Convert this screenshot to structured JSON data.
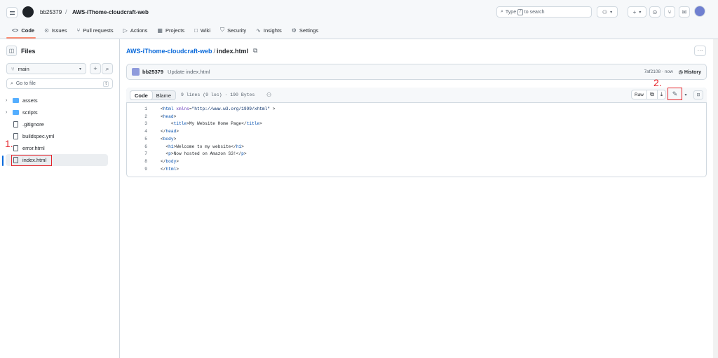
{
  "header": {
    "owner": "bb25379",
    "separator": "/",
    "repo": "AWS-iThome-cloudcraft-web",
    "search_prefix": "Type",
    "search_key": "/",
    "search_suffix": "to search",
    "plus_label": "+"
  },
  "tabs": [
    {
      "label": "Code",
      "icon": "code-icon",
      "glyph": "<>"
    },
    {
      "label": "Issues",
      "icon": "issue-icon",
      "glyph": "⊙"
    },
    {
      "label": "Pull requests",
      "icon": "pull-request-icon",
      "glyph": "⑂"
    },
    {
      "label": "Actions",
      "icon": "play-icon",
      "glyph": "▷"
    },
    {
      "label": "Projects",
      "icon": "table-icon",
      "glyph": "▦"
    },
    {
      "label": "Wiki",
      "icon": "book-icon",
      "glyph": "□"
    },
    {
      "label": "Security",
      "icon": "shield-icon",
      "glyph": "⛉"
    },
    {
      "label": "Insights",
      "icon": "graph-icon",
      "glyph": "∿"
    },
    {
      "label": "Settings",
      "icon": "gear-icon",
      "glyph": "⚙"
    }
  ],
  "sidebar": {
    "title": "Files",
    "branch": "main",
    "goto_placeholder": "Go to file",
    "goto_key": "t",
    "items": [
      {
        "name": "assets",
        "type": "folder"
      },
      {
        "name": "scripts",
        "type": "folder"
      },
      {
        "name": ".gitignore",
        "type": "file"
      },
      {
        "name": "buildspec.yml",
        "type": "file"
      },
      {
        "name": "error.html",
        "type": "file"
      },
      {
        "name": "index.html",
        "type": "file",
        "selected": true
      }
    ]
  },
  "annotations": {
    "step1": "1.",
    "step2": "2."
  },
  "main": {
    "path_repo": "AWS-iThome-cloudcraft-web",
    "path_sep": "/",
    "path_file": "index.html",
    "more_label": "···",
    "commit": {
      "user": "bb25379",
      "message": "Update index.html",
      "sha_time": "7af2108 · now",
      "history": "History"
    },
    "view_tabs": {
      "code": "Code",
      "blame": "Blame"
    },
    "file_info": "9 lines (9 loc) · 190 Bytes",
    "raw": "Raw",
    "code_lines": [
      "<html xmlns=\"http://www.w3.org/1999/xhtml\" >",
      "<head>",
      "    <title>My Website Home Page</title>",
      "</head>",
      "<body>",
      "  <h1>Welcome to my website</h1>",
      "  <p>Now hosted on Amazon S3!</p>",
      "</body>",
      "</html>"
    ]
  },
  "colors": {
    "accent": "#0969da",
    "annotation_red": "#e5242b",
    "tab_underline": "#fd8c73"
  }
}
